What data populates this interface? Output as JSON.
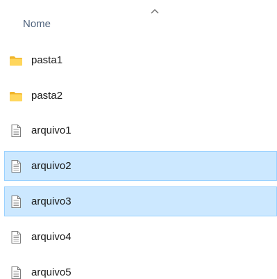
{
  "header": {
    "column_label": "Nome",
    "sort_indicator_icon": "chevron-up-icon"
  },
  "items": [
    {
      "name": "pasta1",
      "type": "folder",
      "icon": "folder-icon",
      "selected": false
    },
    {
      "name": "pasta2",
      "type": "folder",
      "icon": "folder-icon",
      "selected": false
    },
    {
      "name": "arquivo1",
      "type": "file",
      "icon": "document-icon",
      "selected": false
    },
    {
      "name": "arquivo2",
      "type": "file",
      "icon": "document-icon",
      "selected": true
    },
    {
      "name": "arquivo3",
      "type": "file",
      "icon": "document-icon",
      "selected": true
    },
    {
      "name": "arquivo4",
      "type": "file",
      "icon": "document-icon",
      "selected": false
    },
    {
      "name": "arquivo5",
      "type": "file",
      "icon": "document-icon",
      "selected": false
    }
  ],
  "colors": {
    "selection_background": "#cce8ff",
    "selection_border": "#99d1ff",
    "folder": "#ffc83d",
    "header_text": "#4c607a"
  }
}
